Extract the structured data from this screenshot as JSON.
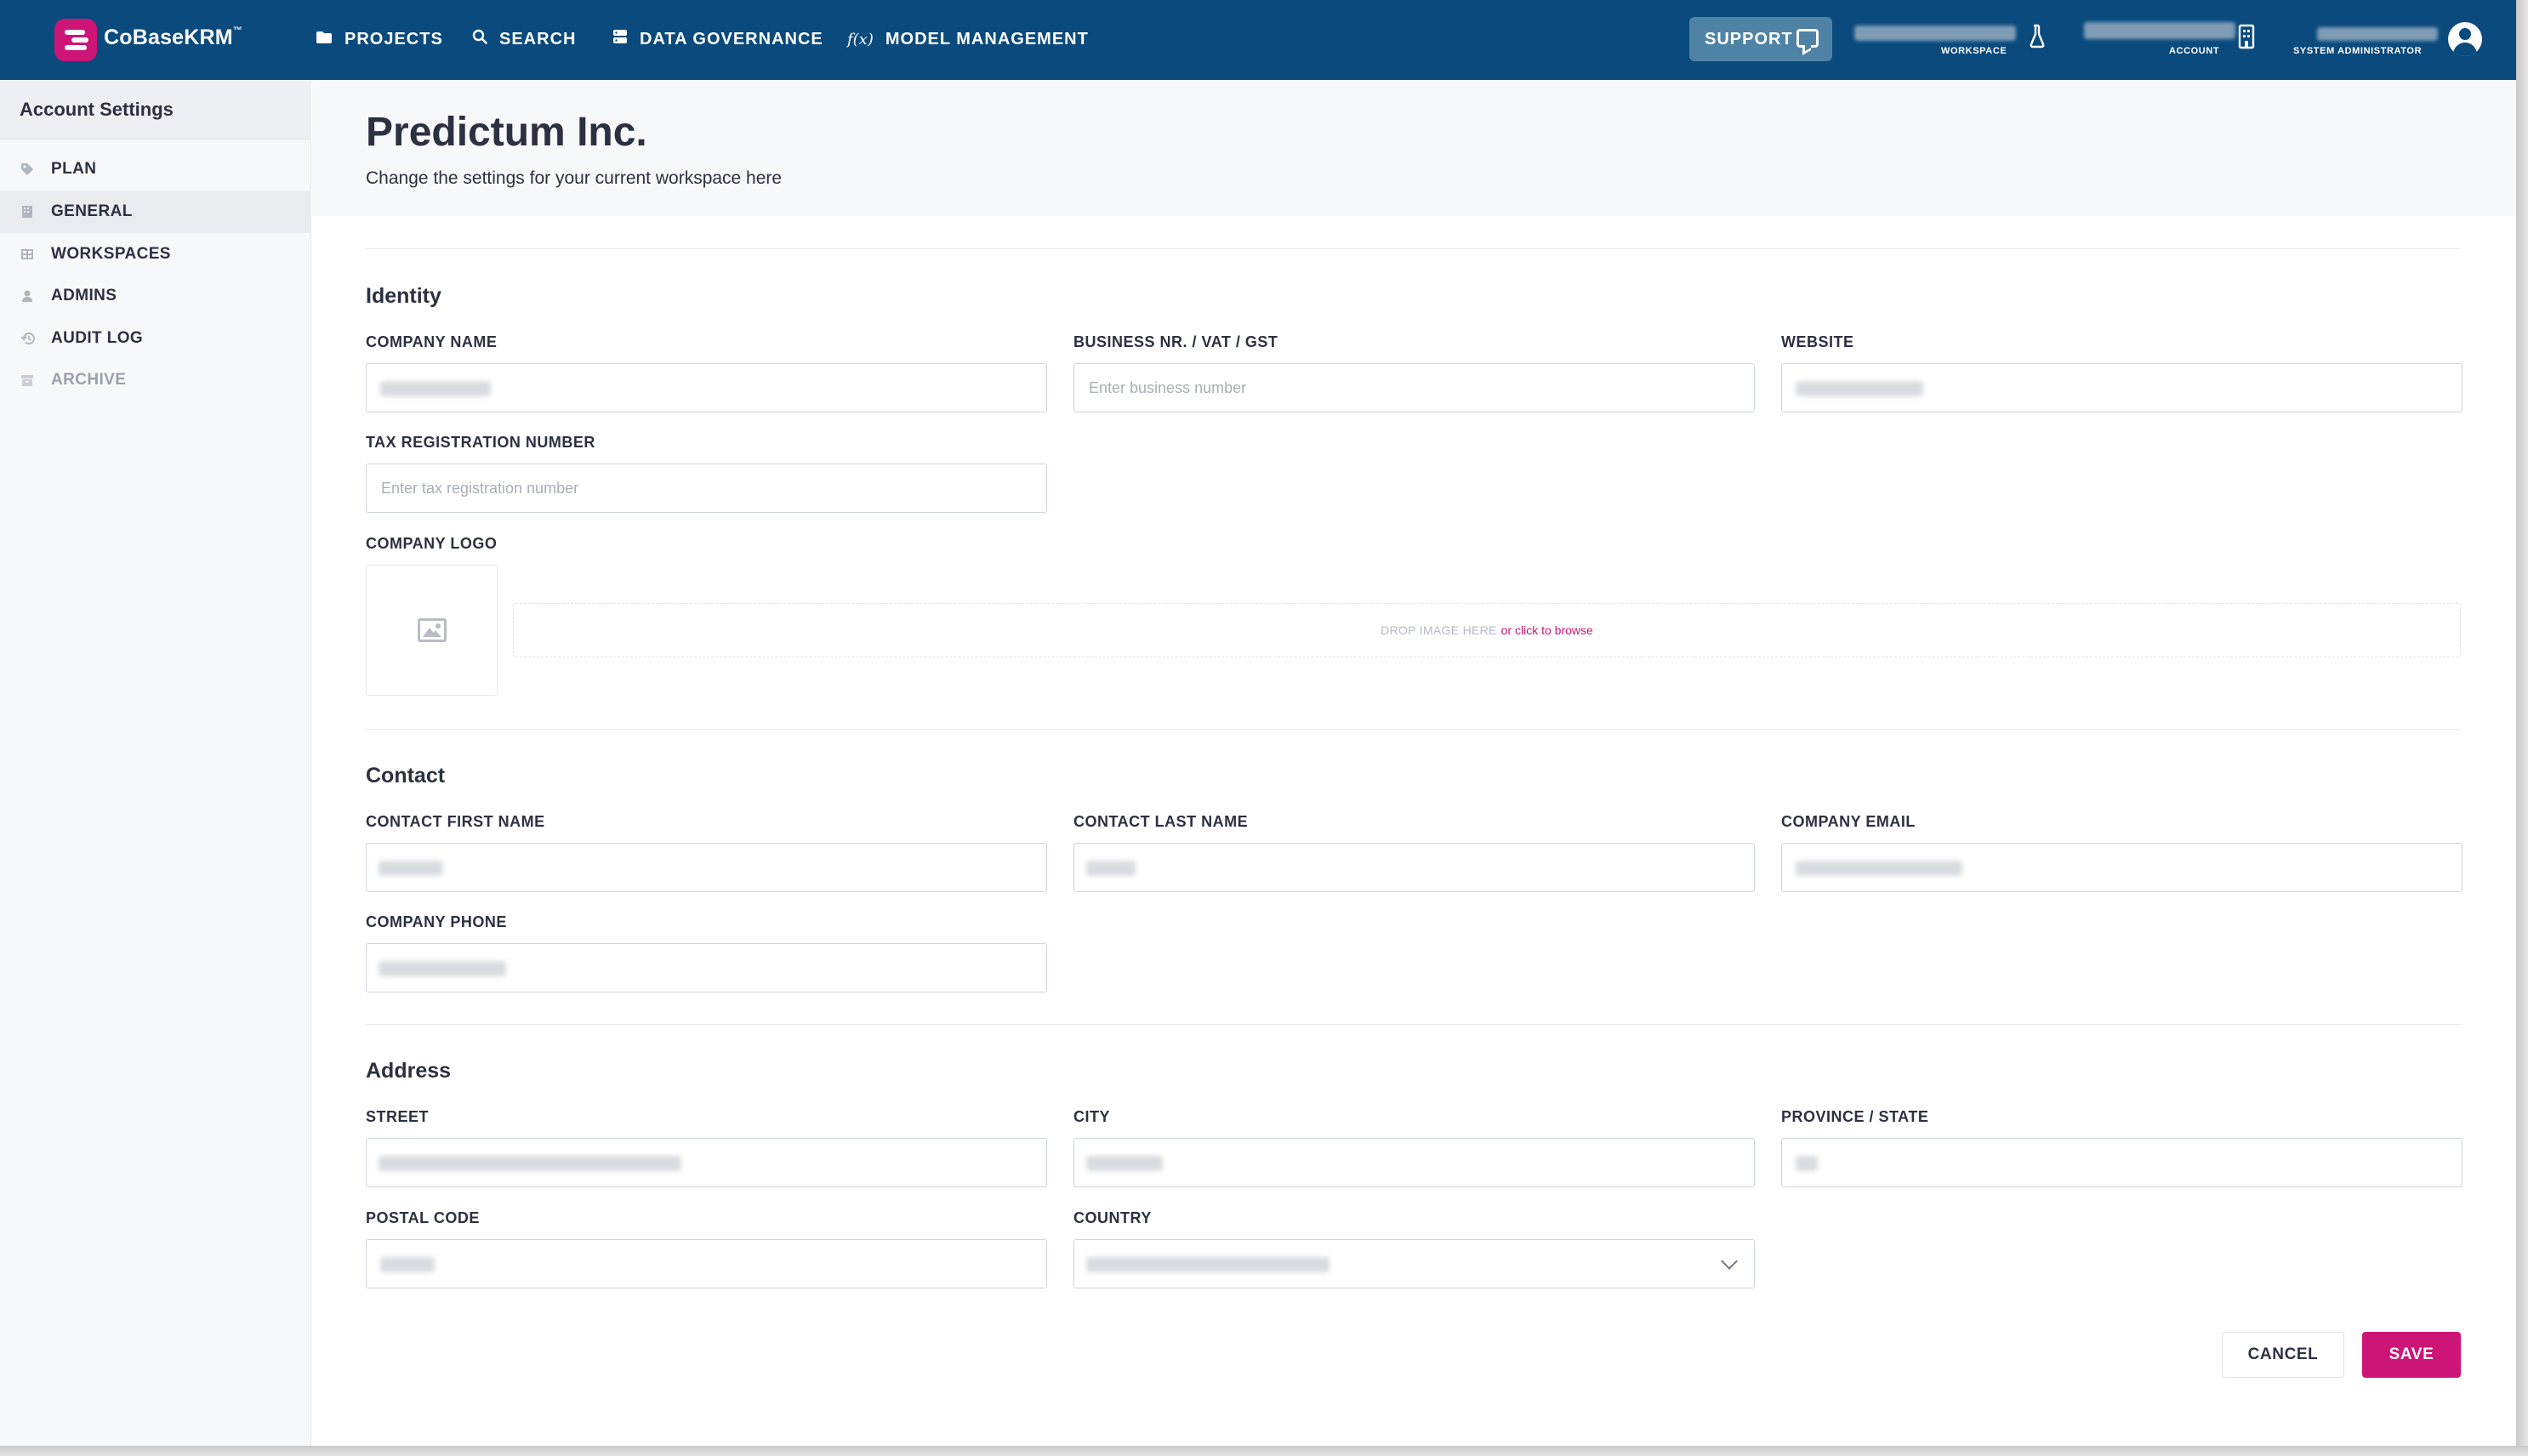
{
  "app": {
    "brand": "CoBaseKRM",
    "brand_tm": "™"
  },
  "topnav": {
    "items": [
      {
        "label": "PROJECTS",
        "icon": "folder-icon"
      },
      {
        "label": "SEARCH",
        "icon": "search-icon"
      },
      {
        "label": "DATA GOVERNANCE",
        "icon": "database-icon"
      },
      {
        "label": "MODEL MANAGEMENT",
        "icon": "function-icon"
      }
    ],
    "function_glyph": "f(x)",
    "support_label": "SUPPORT",
    "workspace_caption": "WORKSPACE",
    "account_caption": "ACCOUNT",
    "user_caption": "SYSTEM ADMINISTRATOR"
  },
  "sidebar": {
    "title": "Account Settings",
    "items": [
      {
        "label": "PLAN",
        "icon": "tag-icon",
        "active": false
      },
      {
        "label": "GENERAL",
        "icon": "building-icon",
        "active": true
      },
      {
        "label": "WORKSPACES",
        "icon": "grid-icon",
        "active": false
      },
      {
        "label": "ADMINS",
        "icon": "user-icon",
        "active": false
      },
      {
        "label": "AUDIT LOG",
        "icon": "history-icon",
        "active": false
      },
      {
        "label": "ARCHIVE",
        "icon": "archive-icon",
        "active": false,
        "disabled": true
      }
    ]
  },
  "page": {
    "title": "Predictum Inc.",
    "subtitle": "Change the settings for your current workspace here"
  },
  "identity": {
    "title": "Identity",
    "company_name_label": "COMPANY NAME",
    "business_nr_label": "BUSINESS NR. / VAT / GST",
    "business_nr_placeholder": "Enter business number",
    "website_label": "WEBSITE",
    "tax_reg_label": "TAX REGISTRATION NUMBER",
    "tax_reg_placeholder": "Enter tax registration number",
    "logo_label": "COMPANY LOGO",
    "dropzone_text": "DROP IMAGE HERE",
    "dropzone_link": "or click to browse"
  },
  "contact": {
    "title": "Contact",
    "first_name_label": "CONTACT FIRST NAME",
    "last_name_label": "CONTACT LAST NAME",
    "email_label": "COMPANY EMAIL",
    "phone_label": "COMPANY PHONE"
  },
  "address": {
    "title": "Address",
    "street_label": "STREET",
    "city_label": "CITY",
    "province_label": "PROVINCE / STATE",
    "postal_label": "POSTAL CODE",
    "country_label": "COUNTRY"
  },
  "actions": {
    "cancel_label": "CANCEL",
    "save_label": "SAVE"
  },
  "colors": {
    "topbar": "#0a4a7d",
    "accent": "#cd1477",
    "support_button": "#4f83a6"
  }
}
